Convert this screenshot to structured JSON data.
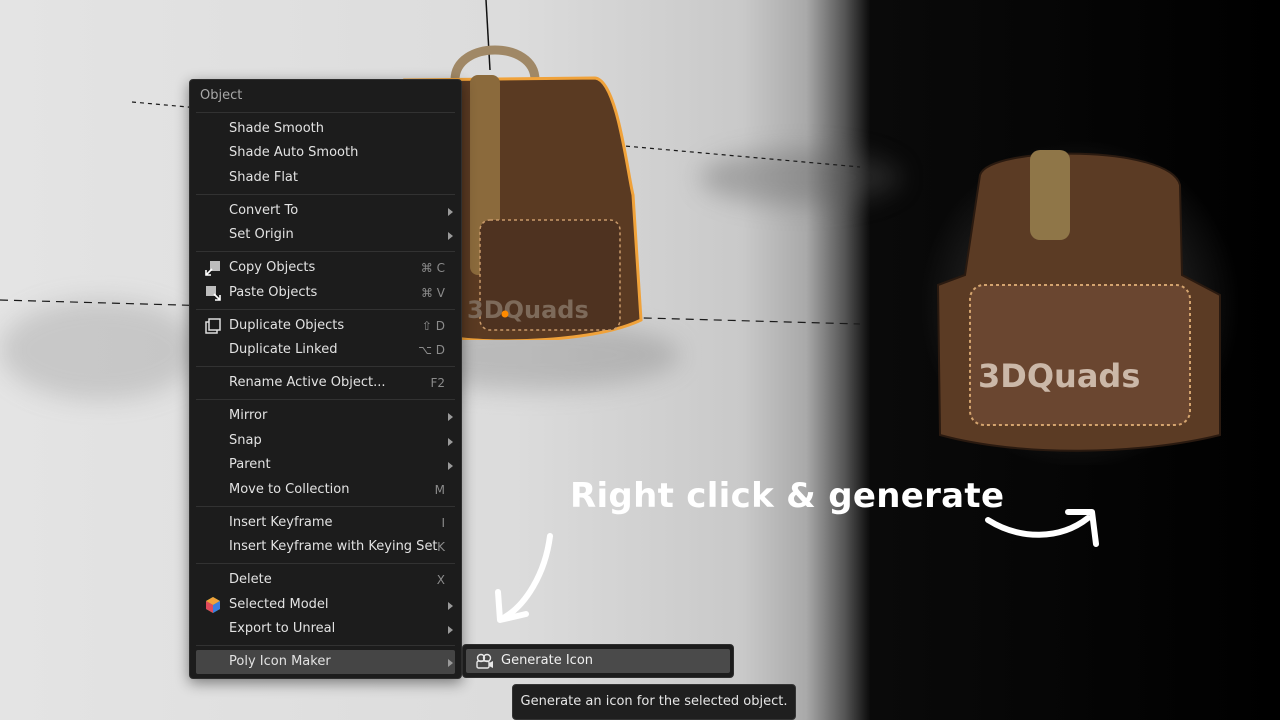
{
  "menu": {
    "header": "Object",
    "items": [
      {
        "label": "Shade Smooth",
        "shortcut": "",
        "submenu": false
      },
      {
        "label": "Shade Auto Smooth",
        "shortcut": "",
        "submenu": false
      },
      {
        "label": "Shade Flat",
        "shortcut": "",
        "submenu": false
      },
      {
        "label": "Convert To",
        "shortcut": "",
        "submenu": true
      },
      {
        "label": "Set Origin",
        "shortcut": "",
        "submenu": true
      },
      {
        "label": "Copy Objects",
        "shortcut": "⌘ C",
        "submenu": false,
        "icon": "copy-icon"
      },
      {
        "label": "Paste Objects",
        "shortcut": "⌘ V",
        "submenu": false,
        "icon": "paste-icon"
      },
      {
        "label": "Duplicate Objects",
        "shortcut": "⇧ D",
        "submenu": false,
        "icon": "duplicate-icon"
      },
      {
        "label": "Duplicate Linked",
        "shortcut": "⌥ D",
        "submenu": false
      },
      {
        "label": "Rename Active Object...",
        "shortcut": "F2",
        "submenu": false
      },
      {
        "label": "Mirror",
        "shortcut": "",
        "submenu": true
      },
      {
        "label": "Snap",
        "shortcut": "",
        "submenu": true
      },
      {
        "label": "Parent",
        "shortcut": "",
        "submenu": true
      },
      {
        "label": "Move to Collection",
        "shortcut": "M",
        "submenu": false
      },
      {
        "label": "Insert Keyframe",
        "shortcut": "I",
        "submenu": false
      },
      {
        "label": "Insert Keyframe with Keying Set",
        "shortcut": "K",
        "submenu": false
      },
      {
        "label": "Delete",
        "shortcut": "X",
        "submenu": false
      },
      {
        "label": "Selected Model",
        "shortcut": "",
        "submenu": true,
        "icon": "hexagon-logo-icon"
      },
      {
        "label": "Export to Unreal",
        "shortcut": "",
        "submenu": true
      },
      {
        "label": "Poly Icon Maker",
        "shortcut": "",
        "submenu": true,
        "active": true
      }
    ]
  },
  "submenu": {
    "label": "Generate Icon",
    "icon": "camera-icon"
  },
  "tooltip": "Generate an icon for the selected object.",
  "annotation": "Right click & generate",
  "preview_text": "3DQuads",
  "viewport_text": "3DQuads",
  "colors": {
    "menu_bg": "#1c1c1c",
    "active_item": "#454545",
    "selection_outline": "#f0a23a",
    "leather": "#5a3a22"
  }
}
